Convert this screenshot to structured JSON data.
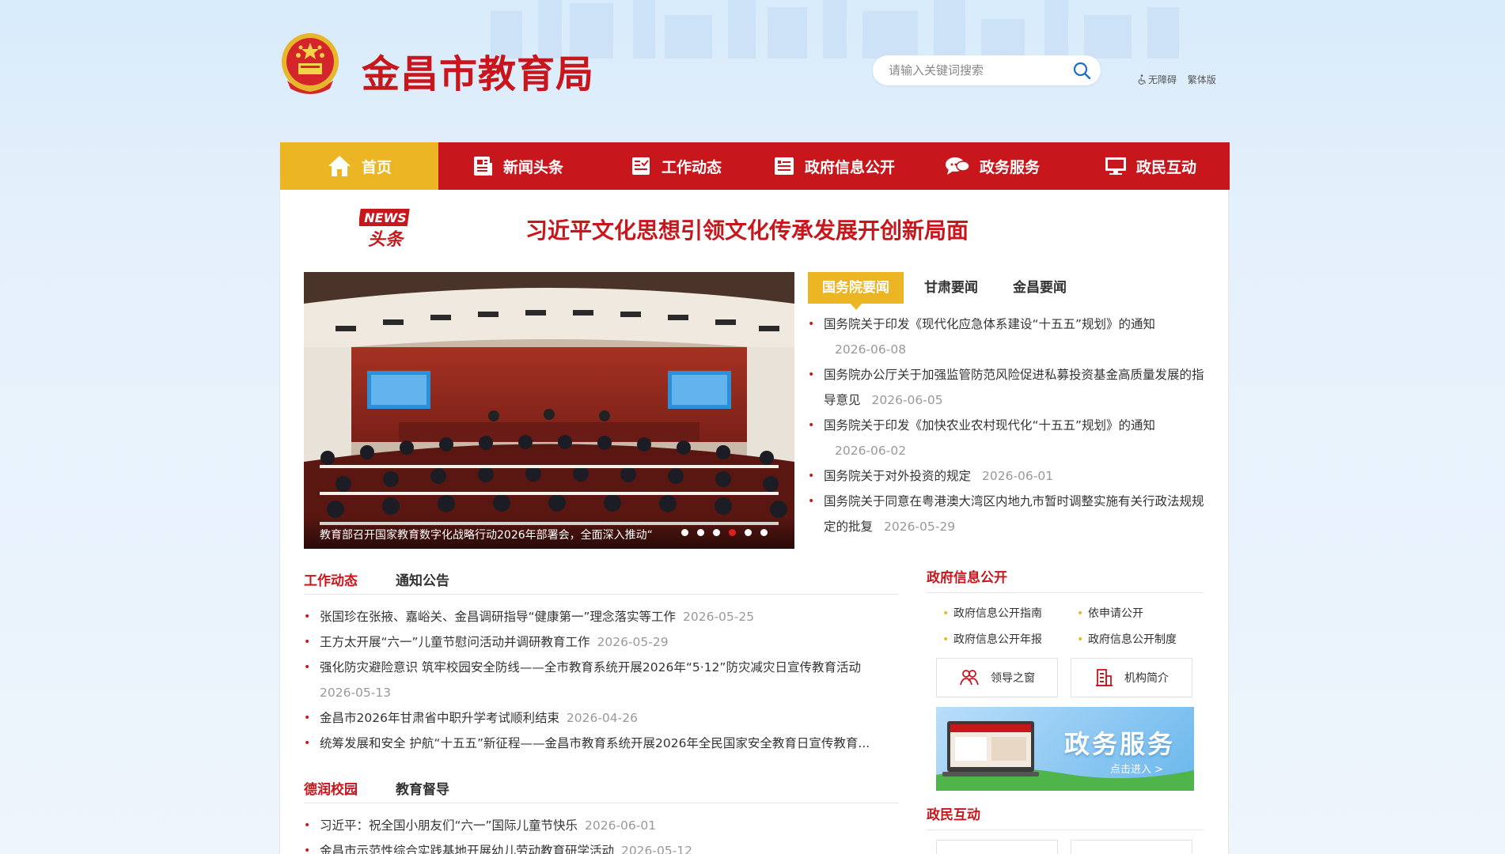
{
  "header": {
    "site_title": "金昌市教育局",
    "search_placeholder": "请输入关键词搜索",
    "accessibility_label": "无障碍",
    "traditional_label": "繁体版"
  },
  "nav": {
    "items": [
      {
        "label": "首页",
        "icon": "home-icon"
      },
      {
        "label": "新闻头条",
        "icon": "news-icon"
      },
      {
        "label": "工作动态",
        "icon": "work-icon"
      },
      {
        "label": "政府信息公开",
        "icon": "document-list-icon"
      },
      {
        "label": "政务服务",
        "icon": "chat-bubble-icon"
      },
      {
        "label": "政民互动",
        "icon": "monitor-icon"
      }
    ]
  },
  "headline": {
    "badge_top": "NEWS",
    "badge_bottom": "头条",
    "title": "习近平文化思想引领文化传承发展开创新局面"
  },
  "slider": {
    "caption": "教育部召开国家教育数字化战略行动2026年部署会，全面深入推动“",
    "dot_count": 6,
    "active_dot": 3
  },
  "news_tabs": {
    "tabs": [
      "国务院要闻",
      "甘肃要闻",
      "金昌要闻"
    ],
    "items": [
      {
        "title": "国务院关于印发《现代化应急体系建设“十五五”规划》的通知",
        "date": "2026-06-08"
      },
      {
        "title": "国务院办公厅关于加强监管防范风险促进私募投资基金高质量发展的指导意见",
        "date": "2026-06-05"
      },
      {
        "title": "国务院关于印发《加快农业农村现代化“十五五”规划》的通知",
        "date": "2026-06-02"
      },
      {
        "title": "国务院关于对外投资的规定",
        "date": "2026-06-01"
      },
      {
        "title": "国务院关于同意在粤港澳大湾区内地九市暂时调整实施有关行政法规规定的批复",
        "date": "2026-05-29"
      }
    ]
  },
  "work_block": {
    "tabs": [
      "工作动态",
      "通知公告"
    ],
    "items": [
      {
        "title": "张国珍在张掖、嘉峪关、金昌调研指导“健康第一”理念落实等工作",
        "date": "2026-05-25"
      },
      {
        "title": "王方太开展“六一”儿童节慰问活动并调研教育工作",
        "date": "2026-05-29"
      },
      {
        "title": "强化防灾避险意识 筑牢校园安全防线——全市教育系统开展2026年“5·12”防灾减灾日宣传教育活动",
        "date": "2026-05-13"
      },
      {
        "title": "金昌市2026年甘肃省中职升学考试顺利结束",
        "date": "2026-04-26"
      },
      {
        "title": "统筹发展和安全 护航“十五五”新征程——金昌市教育系统开展2026年全民国家安全教育日宣传教育...",
        "date": ""
      }
    ]
  },
  "campus_block": {
    "tabs": [
      "德润校园",
      "教育督导"
    ],
    "items": [
      {
        "title": "习近平：祝全国小朋友们“六一”国际儿童节快乐",
        "date": "2026-06-01"
      },
      {
        "title": "金昌市示范性综合实践基地开展幼儿劳动教育研学活动",
        "date": "2026-05-12"
      }
    ]
  },
  "gov_info": {
    "title": "政府信息公开",
    "links": [
      "政府信息公开指南",
      "依申请公开",
      "政府信息公开年报",
      "政府信息公开制度"
    ],
    "buttons": [
      {
        "label": "领导之窗",
        "icon": "leaders-icon"
      },
      {
        "label": "机构简介",
        "icon": "building-icon"
      }
    ]
  },
  "service_banner": {
    "title": "政务服务",
    "subtitle": "点击进入 >"
  },
  "interaction": {
    "title": "政民互动"
  },
  "colors": {
    "brand_red": "#c8161d",
    "accent_gold": "#ebb524",
    "date_gray": "#999999"
  }
}
